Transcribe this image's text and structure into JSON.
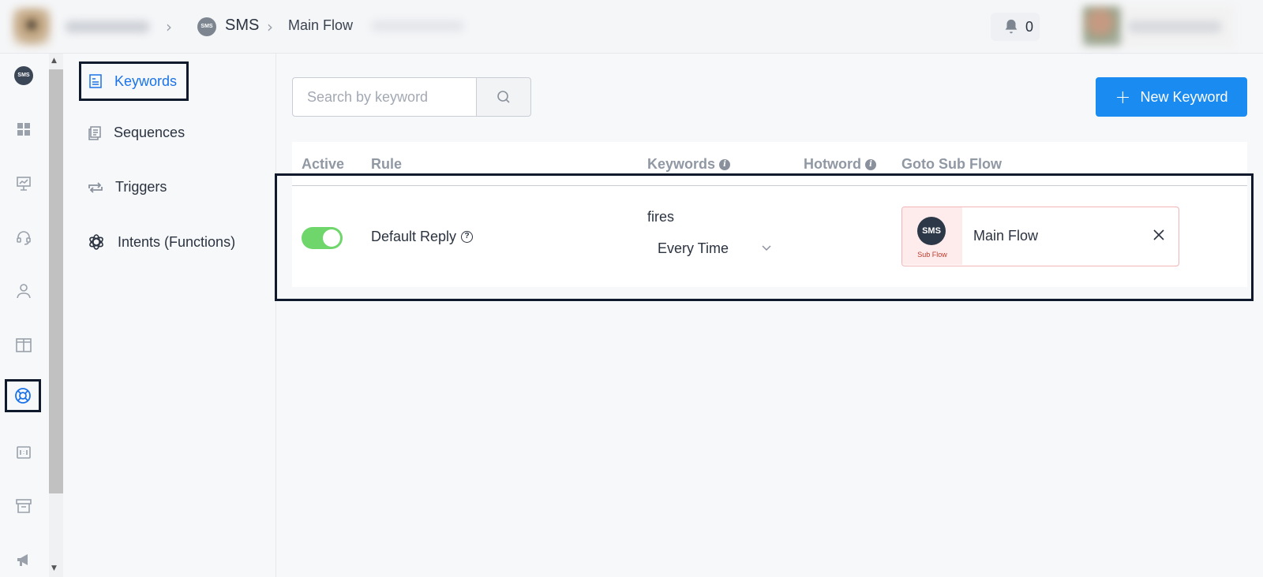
{
  "breadcrumb": {
    "sms_label": "SMS",
    "flow_label": "Main Flow",
    "sms_badge": "SMS"
  },
  "notifications": {
    "count": "0"
  },
  "rail": {
    "sms_badge": "SMS",
    "items": [
      "sms-icon",
      "dashboard-icon",
      "presentation-icon",
      "headset-icon",
      "user-icon",
      "layout-icon",
      "lifebuoy-icon",
      "ratio-icon",
      "archive-icon",
      "megaphone-icon"
    ],
    "selected": "lifebuoy-icon"
  },
  "subnav": {
    "items": [
      {
        "label": "Keywords",
        "icon": "document-icon",
        "active": true
      },
      {
        "label": "Sequences",
        "icon": "copy-icon",
        "active": false
      },
      {
        "label": "Triggers",
        "icon": "repeat-icon",
        "active": false
      },
      {
        "label": "Intents (Functions)",
        "icon": "openai-icon",
        "active": false
      }
    ]
  },
  "search": {
    "placeholder": "Search by keyword",
    "value": ""
  },
  "new_keyword_label": "New Keyword",
  "table": {
    "columns": {
      "active": "Active",
      "rule": "Rule",
      "keywords": "Keywords",
      "hotword": "Hotword",
      "goto": "Goto Sub Flow"
    },
    "rows": [
      {
        "active": true,
        "rule": "Default Reply",
        "keyword": "fires",
        "frequency": "Every Time",
        "hotword": "",
        "subflow": {
          "badge": "SMS",
          "caption": "Sub Flow",
          "name": "Main Flow"
        }
      }
    ]
  },
  "colors": {
    "accent": "#1a8bf0",
    "active_link": "#1a73e8",
    "toggle_on": "#6ed66b",
    "subflow_border": "#f1b5b5",
    "subflow_bg": "#fdeceb"
  }
}
